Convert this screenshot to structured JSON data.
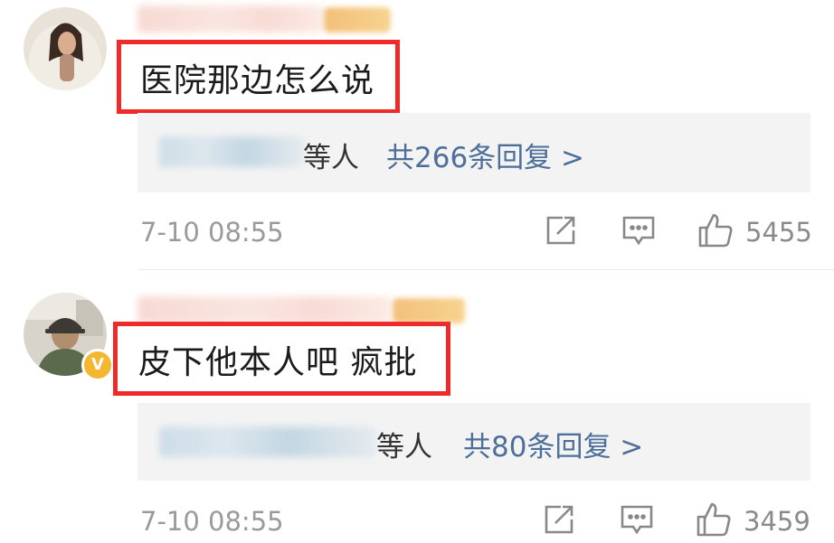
{
  "comments": [
    {
      "text": "医院那边怎么说",
      "reply_suffix": "等人",
      "reply_count_label": "共266条回复 >",
      "time": "7-10 08:55",
      "likes": "5455",
      "icons": [
        "share-icon",
        "comment-icon",
        "like-icon"
      ]
    },
    {
      "text": "皮下他本人吧 疯批",
      "reply_suffix": "等人",
      "reply_count_label": "共80条回复 >",
      "time": "7-10 08:55",
      "likes": "3459",
      "icons": [
        "share-icon",
        "comment-icon",
        "like-icon"
      ],
      "verified": "V"
    }
  ],
  "colors": {
    "highlight_border": "#ee2a2a",
    "link": "#4e6f9a",
    "verified_badge": "#f4b72f"
  }
}
